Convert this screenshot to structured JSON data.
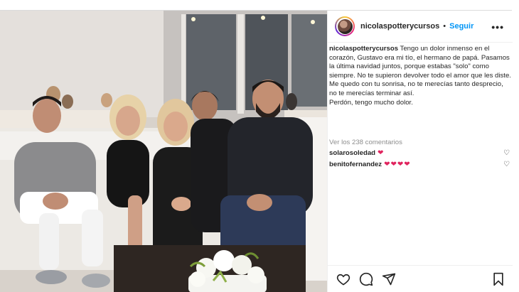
{
  "post": {
    "username": "nicolaspotterycursos",
    "follow_label": "Seguir",
    "separator": "•",
    "more_label": "•••",
    "caption": {
      "username": "nicolaspotterycursos",
      "line1": "Tengo un dolor inmenso en el corazón, Gustavo era mi tío, el hermano de papá. Pasamos la última navidad juntos, porque estabas \"solo\" como siempre. No te supieron devolver todo el amor que les diste.",
      "line2": "Me quedo con tu sonrisa, no te merecías tanto desprecio, no te merecías terminar así.",
      "line3": "Perdón, tengo mucho dolor."
    },
    "view_comments": "Ver los 238 comentarios",
    "comments": [
      {
        "user": "solarosoledad",
        "hearts": "❤"
      },
      {
        "user": "benitofernandez",
        "hearts": "❤❤❤❤"
      }
    ],
    "icons": {
      "like": "heart-icon",
      "comment": "comment-icon",
      "share": "share-icon",
      "save": "bookmark-icon"
    }
  },
  "colors": {
    "link_blue": "#0095f6",
    "heart_red": "#e0245e",
    "muted_gray": "#8e8e8e"
  }
}
